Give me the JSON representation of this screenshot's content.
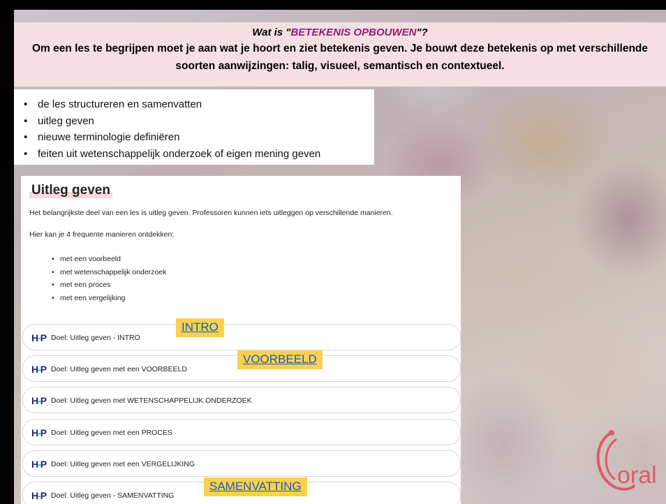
{
  "header": {
    "question_prefix": "Wat is \"",
    "question_highlight": "BETEKENIS OPBOUWEN",
    "question_suffix": "\"?",
    "paragraph": "Om een les te begrijpen moet je aan wat je hoort en ziet betekenis geven. Je bouwt deze betekenis op met verschillende soorten aanwijzingen: talig, visueel, semantisch en contextueel."
  },
  "bullets": [
    "de les structureren en samenvatten",
    "uitleg geven",
    "nieuwe terminologie definiëren",
    "feiten uit wetenschappelijk onderzoek of eigen mening geven"
  ],
  "card": {
    "title": "Uitleg geven",
    "text1": "Het belangrijkste deel van een les is uitleg geven. Professoren kunnen iets uitleggen op verschillende manieren.",
    "text2": "Hier kan je 4 frequente manieren ontdekken:",
    "ways": [
      "met een voorbeeld",
      "met wetenschappelijk onderzoek",
      "met een proces",
      "met een vergelijking"
    ]
  },
  "h5p": {
    "logo_h": "H",
    "logo_dash": "-",
    "logo_p": "P",
    "rows": [
      "Doel: Uitleg geven - INTRO",
      "Doel: Uitleg geven met een VOORBEELD",
      "Doel: Uitleg geven met WETENSCHAPPELIJK ONDERZOEK",
      "Doel: Uitleg geven met een PROCES",
      "Doel: Uitleg geven met een VERGELIJKING",
      "Doel: Uitleg geven - SAMENVATTING"
    ]
  },
  "tags": {
    "intro": "INTRO",
    "voorbeeld": "VOORBEELD",
    "samenvatting": "SAMENVATTING"
  },
  "logo": {
    "text": "oral",
    "color": "#e05a6b"
  },
  "colors": {
    "header_bg": "#f6dfe3",
    "highlight": "#8e1f73",
    "tag_bg": "#fbcf4f",
    "link": "#1a5fb4"
  }
}
